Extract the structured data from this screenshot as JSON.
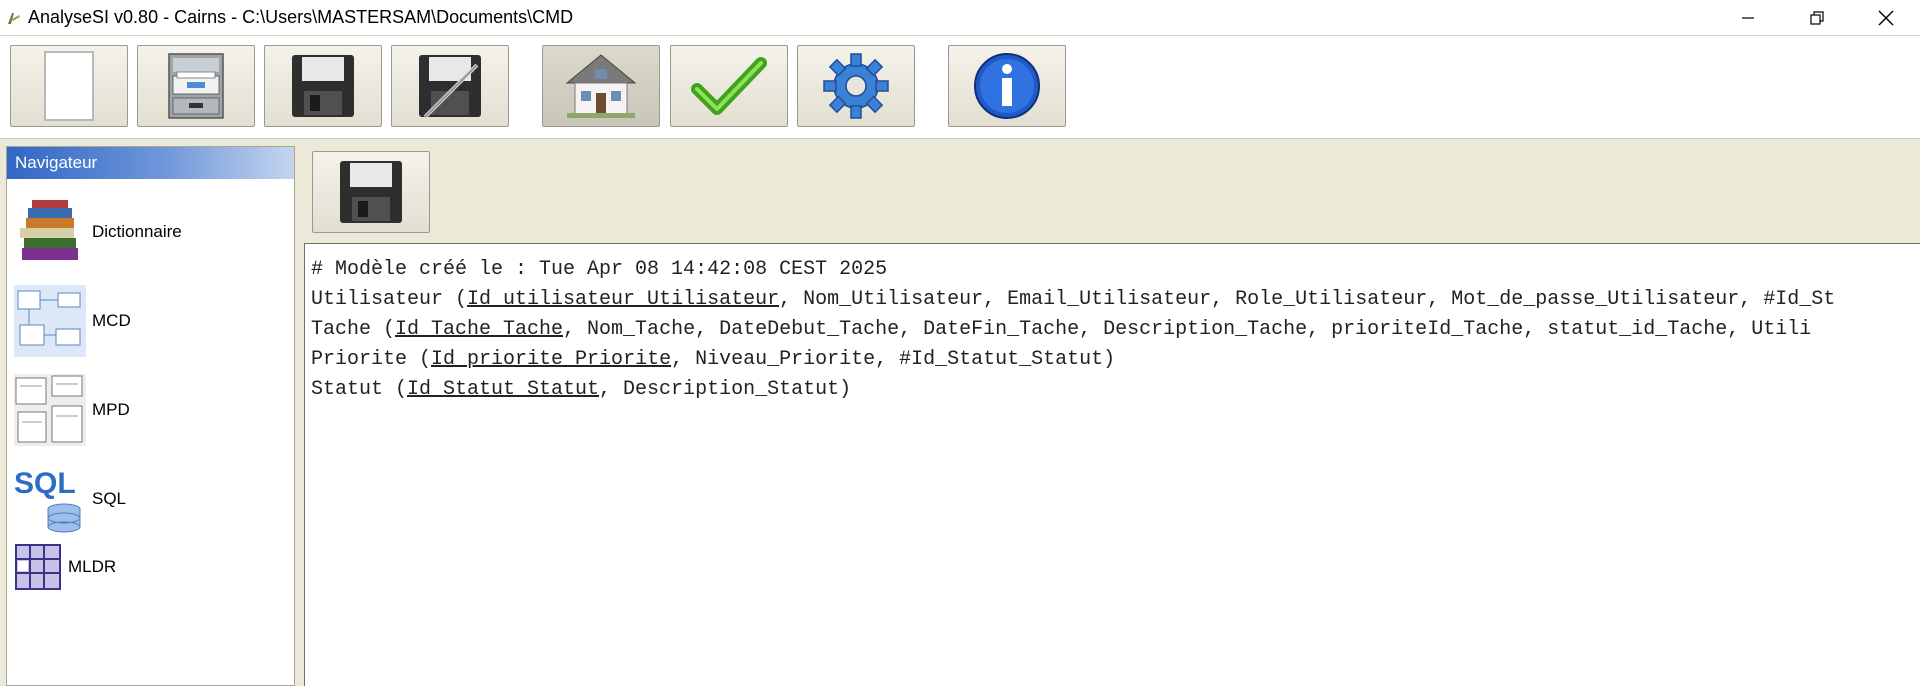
{
  "window": {
    "title": "AnalyseSI v0.80 - Cairns - C:\\Users\\MASTERSAM\\Documents\\CMD"
  },
  "toolbar": {
    "buttons": [
      {
        "name": "new-button",
        "icon": "new-document-icon"
      },
      {
        "name": "open-button",
        "icon": "file-cabinet-icon"
      },
      {
        "name": "save-button",
        "icon": "floppy-disk-icon"
      },
      {
        "name": "save-as-button",
        "icon": "floppy-pen-icon"
      },
      {
        "name": "home-button",
        "icon": "house-icon",
        "active": true
      },
      {
        "name": "validate-button",
        "icon": "checkmark-icon"
      },
      {
        "name": "settings-button",
        "icon": "gear-icon"
      },
      {
        "name": "about-button",
        "icon": "info-icon"
      }
    ]
  },
  "navigator": {
    "title": "Navigateur",
    "items": [
      {
        "label": "Dictionnaire",
        "icon": "books-icon"
      },
      {
        "label": "MCD",
        "icon": "mcd-diagram-icon"
      },
      {
        "label": "MPD",
        "icon": "mpd-diagram-icon"
      },
      {
        "label": "SQL",
        "icon": "sql-database-icon"
      },
      {
        "label": "MLDR",
        "icon": "mldr-table-icon"
      }
    ]
  },
  "editor": {
    "line0": "# Modèle créé le : Tue Apr 08 14:42:08 CEST 2025",
    "line1": {
      "prefix": "Utilisateur (",
      "pk": "Id_utilisateur_Utilisateur",
      "rest": ", Nom_Utilisateur, Email_Utilisateur, Role_Utilisateur, Mot_de_passe_Utilisateur, #Id_St"
    },
    "line2": {
      "prefix": "Tache (",
      "pk": "Id_Tache_Tache",
      "rest": ", Nom_Tache, DateDebut_Tache, DateFin_Tache, Description_Tache, prioriteId_Tache, statut_id_Tache, Utili"
    },
    "line3": {
      "prefix": "Priorite (",
      "pk": "Id_priorite_Priorite",
      "rest": ", Niveau_Priorite, #Id_Statut_Statut)"
    },
    "line4": {
      "prefix": "Statut (",
      "pk": "Id_Statut_Statut",
      "rest": ", Description_Statut)"
    }
  },
  "colors": {
    "background": "#ece9d8",
    "navigator_header": "#3166c4",
    "editor_background": "#ffffff"
  }
}
